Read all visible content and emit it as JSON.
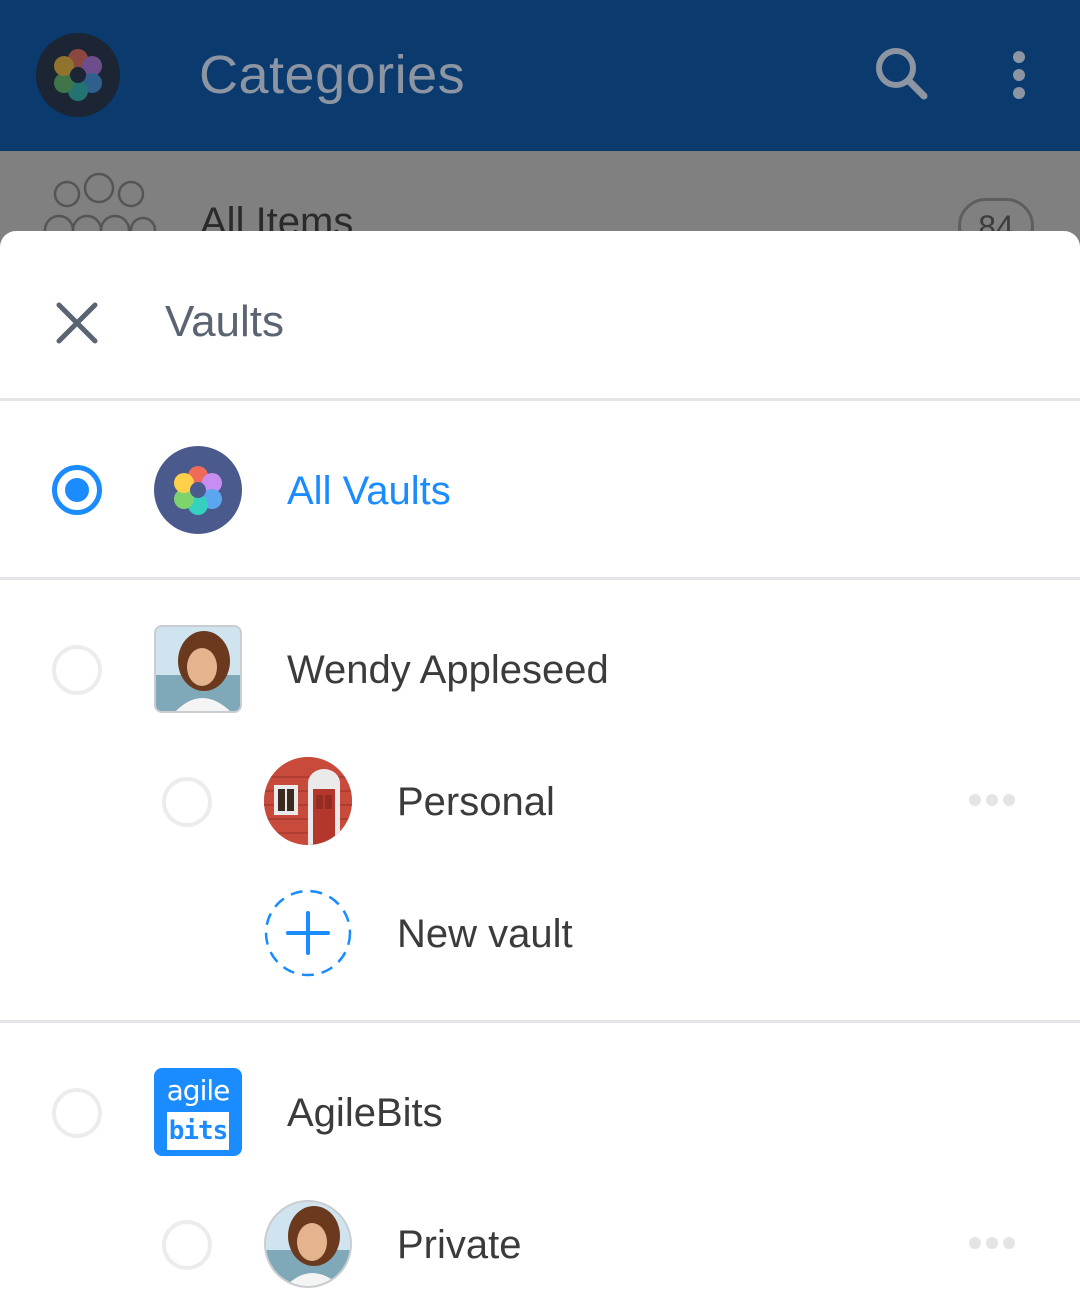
{
  "appbar": {
    "title": "Categories",
    "logo_icon": "vault-flower-icon",
    "search_icon": "search-icon",
    "more_icon": "more-vertical-icon",
    "color": "#0a3a6e"
  },
  "background_list": {
    "all_items_label": "All Items",
    "all_items_count": "84"
  },
  "sheet": {
    "title": "Vaults",
    "close_icon": "close-icon",
    "accent": "#1a8cff",
    "all_vaults": {
      "label": "All Vaults",
      "selected": true
    },
    "accounts": [
      {
        "name": "Wendy Appleseed",
        "avatar": "person-photo",
        "vaults": [
          {
            "label": "Personal",
            "icon": "house-icon",
            "more_icon": "more-horizontal-icon"
          }
        ],
        "new_vault_label": "New vault"
      },
      {
        "name": "AgileBits",
        "avatar": "agilebits-logo",
        "logo_text_top": "agile",
        "logo_text_bottom": "bits",
        "vaults": [
          {
            "label": "Private",
            "icon": "person-photo",
            "more_icon": "more-horizontal-icon"
          }
        ]
      }
    ]
  }
}
